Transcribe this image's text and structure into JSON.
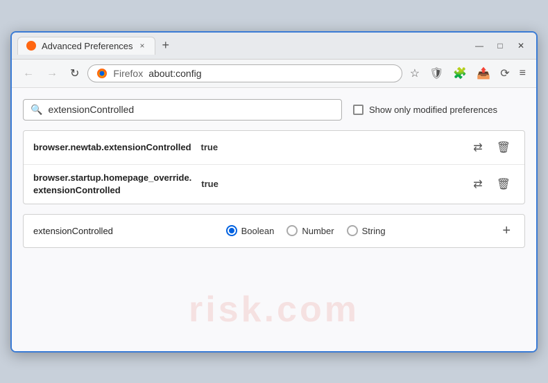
{
  "window": {
    "title": "Advanced Preferences",
    "tab_close_label": "×",
    "new_tab_label": "+",
    "minimize_label": "—",
    "maximize_label": "□",
    "close_label": "✕"
  },
  "nav": {
    "back_label": "←",
    "forward_label": "→",
    "reload_label": "↻",
    "browser_name": "Firefox",
    "url": "about:config",
    "bookmark_icon": "☆",
    "shield_icon": "🛡",
    "extension_icon": "🧩",
    "share_icon": "📤",
    "sync_icon": "⟳",
    "menu_icon": "≡"
  },
  "search": {
    "placeholder": "extensionControlled",
    "value": "extensionControlled",
    "show_modified_label": "Show only modified preferences"
  },
  "preferences": [
    {
      "name": "browser.newtab.extensionControlled",
      "value": "true"
    },
    {
      "name_line1": "browser.startup.homepage_override.",
      "name_line2": "extensionControlled",
      "value": "true"
    }
  ],
  "add_pref": {
    "name": "extensionControlled",
    "type_boolean": "Boolean",
    "type_number": "Number",
    "type_string": "String",
    "add_btn_label": "+"
  },
  "watermark": "risk.com"
}
